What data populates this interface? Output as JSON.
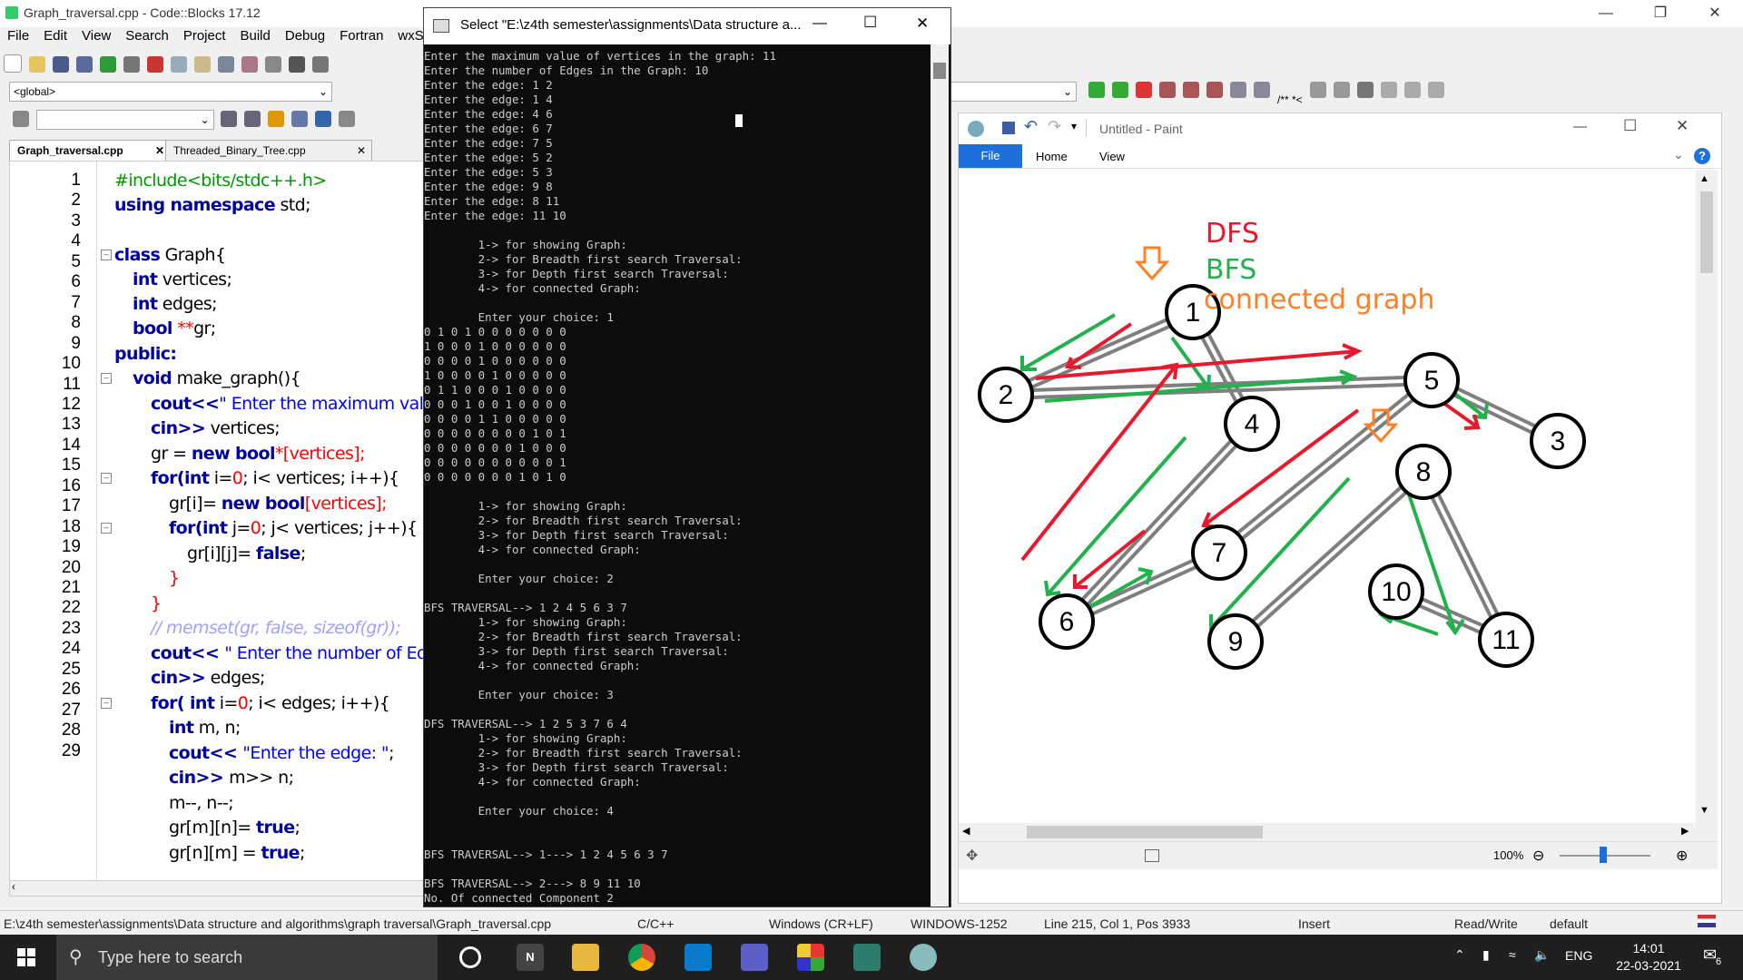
{
  "codeblocks": {
    "title": "Graph_traversal.cpp - Code::Blocks 17.12",
    "menu": [
      "File",
      "Edit",
      "View",
      "Search",
      "Project",
      "Build",
      "Debug",
      "Fortran",
      "wxS"
    ],
    "scope_combo": "<global>",
    "tabs": [
      "Graph_traversal.cpp",
      "Threaded_Binary_Tree.cpp"
    ],
    "line_numbers": [
      "1",
      "2",
      "3",
      "4",
      "5",
      "6",
      "7",
      "8",
      "9",
      "10",
      "11",
      "12",
      "13",
      "14",
      "15",
      "16",
      "17",
      "18",
      "19",
      "20",
      "21",
      "22",
      "23",
      "24",
      "25",
      "26",
      "27",
      "28",
      "29"
    ],
    "code": {
      "l1": "#include<bits/stdc++.h>",
      "l2a": "using namespace",
      "l2b": " std;",
      "l4a": "class",
      "l4b": " Graph{",
      "l5a": "int",
      "l5b": " vertices;",
      "l6a": "int",
      "l6b": " edges;",
      "l7a": "bool",
      "l7b": " **",
      "l7c": "gr;",
      "l8": "public:",
      "l9a": "void",
      "l9b": " make_graph(){",
      "l10a": "cout<<",
      "l10b": "\" Enter the maximum value of",
      "l11a": "cin>>",
      "l11b": " vertices;",
      "l12a": "gr = ",
      "l12b": "new bool",
      "l12c": "*[vertices];",
      "l13a": "for(",
      "l13b": "int",
      "l13c": " i=",
      "l13d": "0",
      "l13e": "; i< vertices; i++){",
      "l14a": "gr[i]= ",
      "l14b": "new bool",
      "l14c": "[vertices];",
      "l15a": "for(",
      "l15b": "int",
      "l15c": " j=",
      "l15d": "0",
      "l15e": "; j< vertices; j++){",
      "l16a": "gr[i][j]= ",
      "l16b": "false",
      "l16c": ";",
      "l17": "}",
      "l18": "}",
      "l19": "// memset(gr, false, sizeof(gr));",
      "l20a": "cout<< ",
      "l20b": "\" Enter the number of Edges",
      "l21a": "cin>>",
      "l21b": " edges;",
      "l22a": "for( ",
      "l22b": "int",
      "l22c": " i=",
      "l22d": "0",
      "l22e": "; i< edges; i++){",
      "l23a": "int",
      "l23b": " m, n;",
      "l24a": "cout<< ",
      "l24b": "\"Enter the edge: \"",
      "l24c": ";",
      "l25a": "cin>> ",
      "l25b": "m>> n;",
      "l26": "m--, n--;",
      "l27a": "gr[m][n]= ",
      "l27b": "true",
      "l27c": ";",
      "l28a": "gr[n][m] = ",
      "l28b": "true",
      "l28c": ";"
    },
    "status": {
      "path": "E:\\z4th semester\\assignments\\Data structure and algorithms\\graph traversal\\Graph_traversal.cpp",
      "lang": "C/C++",
      "eol": "Windows (CR+LF)",
      "encoding": "WINDOWS-1252",
      "position": "Line 215, Col 1, Pos 3933",
      "mode": "Insert",
      "access": "Read/Write",
      "profile": "default"
    }
  },
  "console": {
    "title": "Select \"E:\\z4th semester\\assignments\\Data structure a...",
    "lines": [
      "Enter the maximum value of vertices in the graph: 11",
      "Enter the number of Edges in the Graph: 10",
      "Enter the edge: 1 2",
      "Enter the edge: 1 4",
      "Enter the edge: 4 6",
      "Enter the edge: 6 7",
      "Enter the edge: 7 5",
      "Enter the edge: 5 2",
      "Enter the edge: 5 3",
      "Enter the edge: 9 8",
      "Enter the edge: 8 11",
      "Enter the edge: 11 10",
      "",
      "        1-> for showing Graph:",
      "        2-> for Breadth first search Traversal:",
      "        3-> for Depth first search Traversal:",
      "        4-> for connected Graph:",
      "",
      "        Enter your choice: 1",
      "0 1 0 1 0 0 0 0 0 0 0",
      "1 0 0 0 1 0 0 0 0 0 0",
      "0 0 0 0 1 0 0 0 0 0 0",
      "1 0 0 0 0 1 0 0 0 0 0",
      "0 1 1 0 0 0 1 0 0 0 0",
      "0 0 0 1 0 0 1 0 0 0 0",
      "0 0 0 0 1 1 0 0 0 0 0",
      "0 0 0 0 0 0 0 0 1 0 1",
      "0 0 0 0 0 0 0 1 0 0 0",
      "0 0 0 0 0 0 0 0 0 0 1",
      "0 0 0 0 0 0 0 1 0 1 0",
      "",
      "        1-> for showing Graph:",
      "        2-> for Breadth first search Traversal:",
      "        3-> for Depth first search Traversal:",
      "        4-> for connected Graph:",
      "",
      "        Enter your choice: 2",
      "",
      "BFS TRAVERSAL--> 1 2 4 5 6 3 7",
      "        1-> for showing Graph:",
      "        2-> for Breadth first search Traversal:",
      "        3-> for Depth first search Traversal:",
      "        4-> for connected Graph:",
      "",
      "        Enter your choice: 3",
      "",
      "DFS TRAVERSAL--> 1 2 5 3 7 6 4",
      "        1-> for showing Graph:",
      "        2-> for Breadth first search Traversal:",
      "        3-> for Depth first search Traversal:",
      "        4-> for connected Graph:",
      "",
      "        Enter your choice: 4",
      "",
      "",
      "BFS TRAVERSAL--> 1---> 1 2 4 5 6 3 7",
      "",
      "BFS TRAVERSAL--> 2---> 8 9 11 10",
      "No. Of connected Component 2"
    ]
  },
  "paint": {
    "title": "Untitled - Paint",
    "tabs": [
      "File",
      "Home",
      "View"
    ],
    "zoom": "100%",
    "legend": {
      "dfs": "DFS",
      "bfs": "BFS",
      "connected": "connected graph"
    },
    "colors": {
      "dfs": "#e8192c",
      "bfs": "#22b14c",
      "connected": "#ff7f27",
      "edge": "#7f7f7f"
    },
    "nodes": [
      "1",
      "2",
      "3",
      "4",
      "5",
      "6",
      "7",
      "8",
      "9",
      "10",
      "11"
    ]
  },
  "taskbar": {
    "search_placeholder": "Type here to search",
    "lang": "ENG",
    "time": "14:01",
    "date": "22-03-2021",
    "notifications": "6"
  }
}
